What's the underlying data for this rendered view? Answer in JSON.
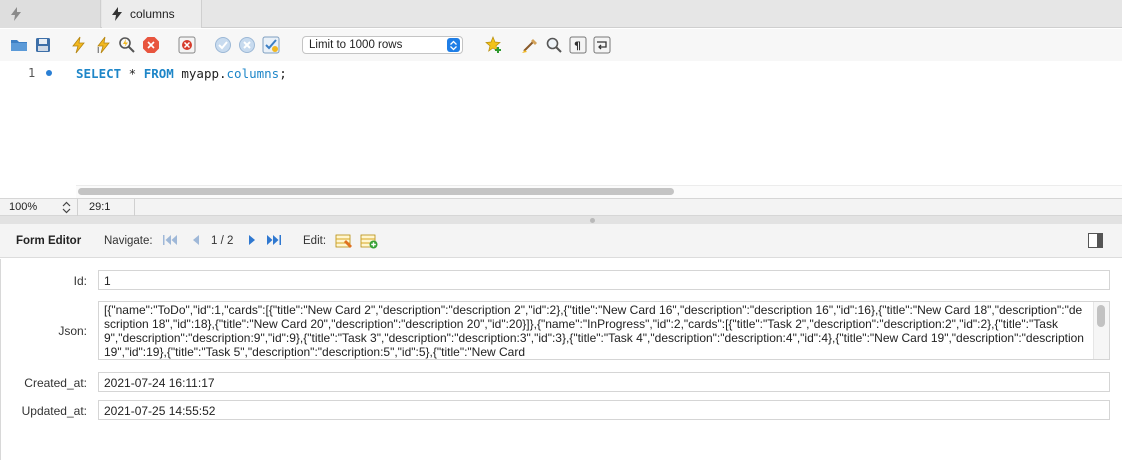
{
  "tabs": [
    {
      "label": "",
      "icon": "lightning-icon"
    },
    {
      "label": "columns",
      "icon": "lightning-icon"
    }
  ],
  "toolbar": {
    "limit_select": {
      "value": "Limit to 1000 rows"
    },
    "icons": [
      "open-folder-icon",
      "save-icon",
      "execute-icon",
      "execute-current-icon",
      "explain-icon",
      "stop-icon",
      "toggle-error-icon",
      "commit-icon",
      "rollback-icon",
      "autocommit-icon",
      "add-snippet-icon",
      "beautify-icon",
      "find-icon",
      "invisible-chars-icon",
      "wrap-icon"
    ]
  },
  "editor": {
    "line_number": "1",
    "query": {
      "kw_select": "SELECT",
      "star": " * ",
      "kw_from": "FROM",
      "schema": " myapp.",
      "table": "columns",
      "end": ";"
    }
  },
  "status": {
    "zoom": "100%",
    "cursor": "29:1"
  },
  "form_editor": {
    "title": "Form Editor",
    "navigate_label": "Navigate:",
    "page_indicator": "1 / 2",
    "edit_label": "Edit:"
  },
  "fields": {
    "id": {
      "label": "Id:",
      "value": "1"
    },
    "json": {
      "label": "Json:",
      "value": "[{\"name\":\"ToDo\",\"id\":1,\"cards\":[{\"title\":\"New Card 2\",\"description\":\"description 2\",\"id\":2},{\"title\":\"New Card 16\",\"description\":\"description 16\",\"id\":16},{\"title\":\"New Card 18\",\"description\":\"description 18\",\"id\":18},{\"title\":\"New Card 20\",\"description\":\"description 20\",\"id\":20}]},{\"name\":\"InProgress\",\"id\":2,\"cards\":[{\"title\":\"Task 2\",\"description\":\"description:2\",\"id\":2},{\"title\":\"Task 9\",\"description\":\"description:9\",\"id\":9},{\"title\":\"Task 3\",\"description\":\"description:3\",\"id\":3},{\"title\":\"Task 4\",\"description\":\"description:4\",\"id\":4},{\"title\":\"New Card 19\",\"description\":\"description 19\",\"id\":19},{\"title\":\"Task 5\",\"description\":\"description:5\",\"id\":5},{\"title\":\"New Card"
    },
    "created_at": {
      "label": "Created_at:",
      "value": "2021-07-24 16:11:17"
    },
    "updated_at": {
      "label": "Updated_at:",
      "value": "2021-07-25 14:55:52"
    }
  },
  "colors": {
    "accent": "#1f7ee6",
    "keyword": "#1e86c8"
  }
}
